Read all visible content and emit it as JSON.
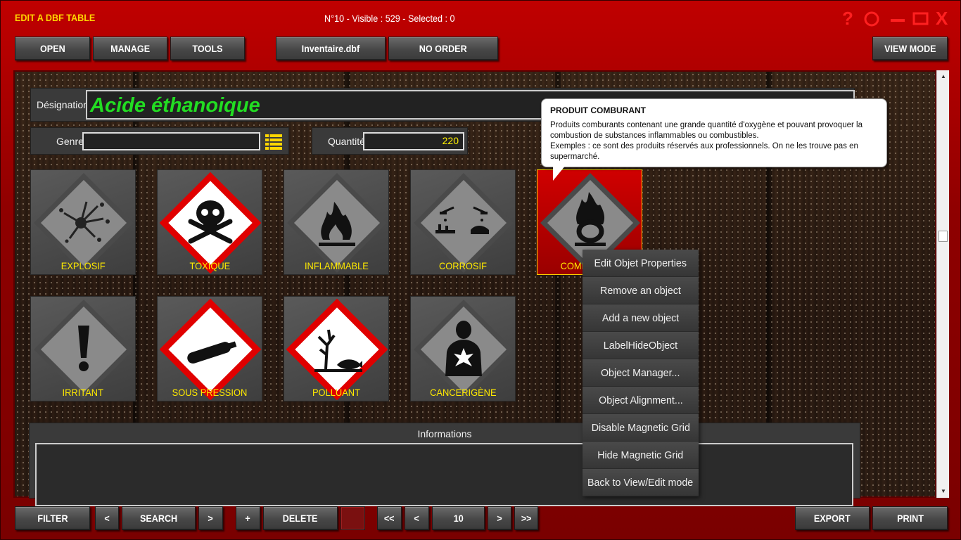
{
  "window": {
    "title": "EDIT A DBF TABLE",
    "status": "N°10 - Visible : 529 - Selected : 0",
    "controls": {
      "help": "?",
      "max": "☐",
      "close": "X"
    }
  },
  "toolbar": {
    "open": "OPEN",
    "manage": "MANAGE",
    "tools": "TOOLS",
    "file": "Inventaire.dbf",
    "order": "NO ORDER",
    "view_mode": "VIEW MODE"
  },
  "form": {
    "designation_label": "Désignation",
    "designation_value": "Acide éthanoique",
    "genre_label": "Genre",
    "genre_value": "",
    "quantite_label": "Quantité",
    "quantite_value": "220"
  },
  "tiles": [
    {
      "label": "EXPLOSIF",
      "icon": "explosive-pictogram-icon"
    },
    {
      "label": "TOXIQUE",
      "icon": "skull-crossbones-pictogram-icon"
    },
    {
      "label": "INFLAMMABLE",
      "icon": "flame-pictogram-icon"
    },
    {
      "label": "CORROSIF",
      "icon": "corrosion-pictogram-icon"
    },
    {
      "label": "COMBURANT",
      "icon": "flame-over-circle-pictogram-icon"
    },
    {
      "label": "IRRITANT",
      "icon": "exclamation-pictogram-icon"
    },
    {
      "label": "SOUS PRESSION",
      "icon": "gas-cylinder-pictogram-icon"
    },
    {
      "label": "POLLUANT",
      "icon": "environment-pictogram-icon"
    },
    {
      "label": "CANCERIGÈNE",
      "icon": "health-hazard-pictogram-icon"
    }
  ],
  "tooltip": {
    "title": "PRODUIT COMBURANT",
    "line1": "Produits comburants contenant une grande quantité d'oxygène et pouvant provoquer la combustion de substances inflammables ou combustibles.",
    "line2": "Exemples : ce sont des produits réservés aux professionnels. On ne les trouve pas en supermarché."
  },
  "context_menu": [
    "Edit Objet Properties",
    "Remove an object",
    "Add a new object",
    "LabelHideObject",
    "Object Manager...",
    "Object Alignment...",
    "Disable Magnetic Grid",
    "Hide Magnetic Grid",
    "Back to View/Edit mode"
  ],
  "info": {
    "title": "Informations"
  },
  "bottom": {
    "filter": "FILTER",
    "prev": "<",
    "search": "SEARCH",
    "next": ">",
    "plus": "+",
    "delete": "DELETE",
    "first": "<<",
    "prev_rec": "<",
    "record": "10",
    "next_rec": ">",
    "last": ">>",
    "export": "EXPORT",
    "print": "PRINT"
  },
  "colors": {
    "frame": "#b00000",
    "label_yellow": "#ffea00",
    "designation_green": "#22dd22",
    "ghs_red": "#e00000"
  }
}
